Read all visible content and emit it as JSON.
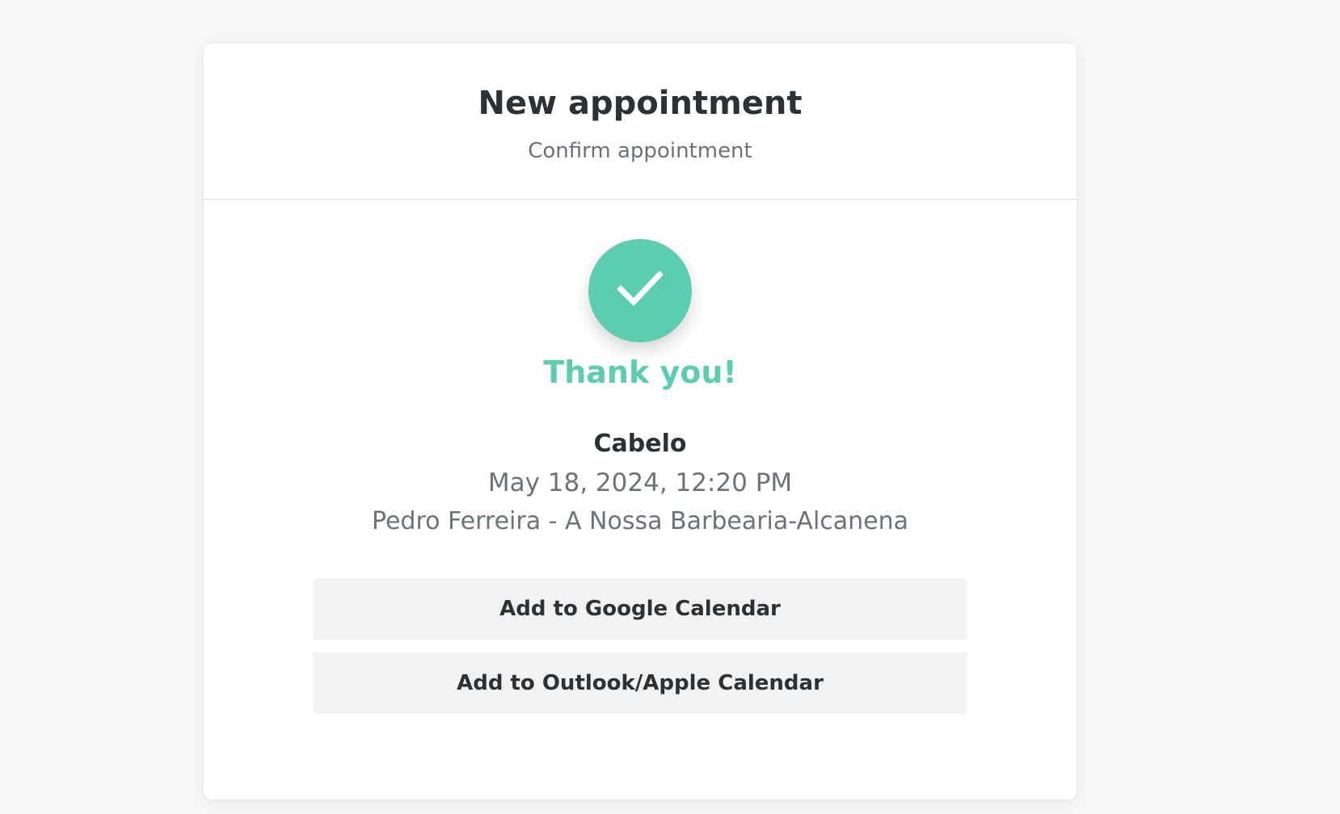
{
  "header": {
    "title": "New appointment",
    "subtitle": "Confirm appointment"
  },
  "confirmation": {
    "icon": "check-icon",
    "message": "Thank you!",
    "service": "Cabelo",
    "datetime": "May 18, 2024, 12:20 PM",
    "location": "Pedro Ferreira - A Nossa Barbearia-Alcanena"
  },
  "actions": {
    "google_label": "Add to Google Calendar",
    "outlook_apple_label": "Add to Outlook/Apple Calendar"
  },
  "colors": {
    "accent": "#5ccdaf",
    "text_dark": "#2c3136",
    "text_muted": "#6c727a",
    "button_bg": "#f2f2f2",
    "page_bg": "#f7f8fa"
  }
}
